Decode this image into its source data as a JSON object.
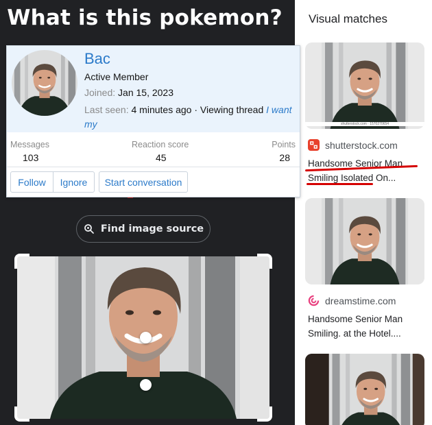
{
  "meme": {
    "caption": "What is this pokemon?"
  },
  "lens": {
    "find_source_label": "Find image source"
  },
  "visual_matches": {
    "title": "Visual matches",
    "items": [
      {
        "source": "shutterstock.com",
        "title": "Handsome Senior Man Smiling Isolated On...",
        "watermark": "shutterstock.com · 1570270654",
        "favicon_color": "#e8412c",
        "favicon": "shutterstock-icon"
      },
      {
        "source": "dreamstime.com",
        "title": "Handsome Senior Man Smiling. at the Hotel....",
        "favicon_color": "#e8417f",
        "favicon": "dreamstime-icon"
      },
      {
        "source": "",
        "title": ""
      }
    ]
  },
  "profile": {
    "username": "Bac",
    "user_title": "Active Member",
    "joined_label": "Joined:",
    "joined_value": "Jan 15, 2023",
    "last_seen_label": "Last seen:",
    "last_seen_value": "4 minutes ago · Viewing thread",
    "last_seen_link": "I want my",
    "stats": [
      {
        "label": "Messages",
        "value": "103"
      },
      {
        "label": "Reaction score",
        "value": "45"
      },
      {
        "label": "Points",
        "value": "28"
      }
    ],
    "buttons": {
      "follow": "Follow",
      "ignore": "Ignore",
      "start_conversation": "Start conversation"
    },
    "accent_color": "#2b7ac9"
  }
}
